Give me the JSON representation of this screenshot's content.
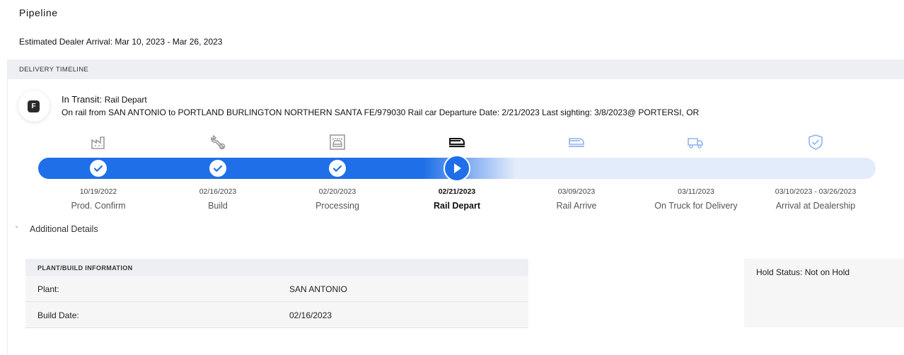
{
  "page": {
    "title": "Pipeline",
    "estimated_arrival": "Estimated Dealer Arrival: Mar 10, 2023 - Mar 26, 2023"
  },
  "timeline": {
    "header": "DELIVERY TIMELINE",
    "badge": "F",
    "status_prefix": "In Transit:",
    "status_sub": "Rail Depart",
    "description": "On rail from SAN ANTONIO to PORTLAND BURLINGTON NORTHERN SANTA FE/979030 Rail car Departure Date: 2/21/2023 Last sighting: 3/8/2023@ PORTERSI, OR",
    "progress_fraction": 0.5,
    "steps": [
      {
        "date": "10/19/2022",
        "label": "Prod. Confirm",
        "state": "complete",
        "icon": "factory-icon"
      },
      {
        "date": "02/16/2023",
        "label": "Build",
        "state": "complete",
        "icon": "wrench-icon"
      },
      {
        "date": "02/20/2023",
        "label": "Processing",
        "state": "complete",
        "icon": "car-wash-icon"
      },
      {
        "date": "02/21/2023",
        "label": "Rail Depart",
        "state": "current",
        "icon": "train-icon"
      },
      {
        "date": "03/09/2023",
        "label": "Rail Arrive",
        "state": "pending",
        "icon": "train-arrive-icon"
      },
      {
        "date": "03/11/2023",
        "label": "On Truck for Delivery",
        "state": "pending",
        "icon": "truck-icon"
      },
      {
        "date": "03/10/2023 - 03/26/2023",
        "label": "Arrival at Dealership",
        "state": "pending",
        "icon": "shield-check-icon"
      }
    ]
  },
  "details": {
    "toggle_label": "Additional Details",
    "plant_header": "PLANT/BUILD INFORMATION",
    "rows": [
      {
        "key": "Plant:",
        "value": "SAN ANTONIO"
      },
      {
        "key": "Build Date:",
        "value": "02/16/2023"
      }
    ],
    "hold_status": "Hold Status: Not on Hold"
  },
  "colors": {
    "accent": "#1f6fe8",
    "track_pending": "#e3ecfb",
    "icon_done": "#9a9a9a",
    "icon_pending": "#8fb3ef"
  }
}
